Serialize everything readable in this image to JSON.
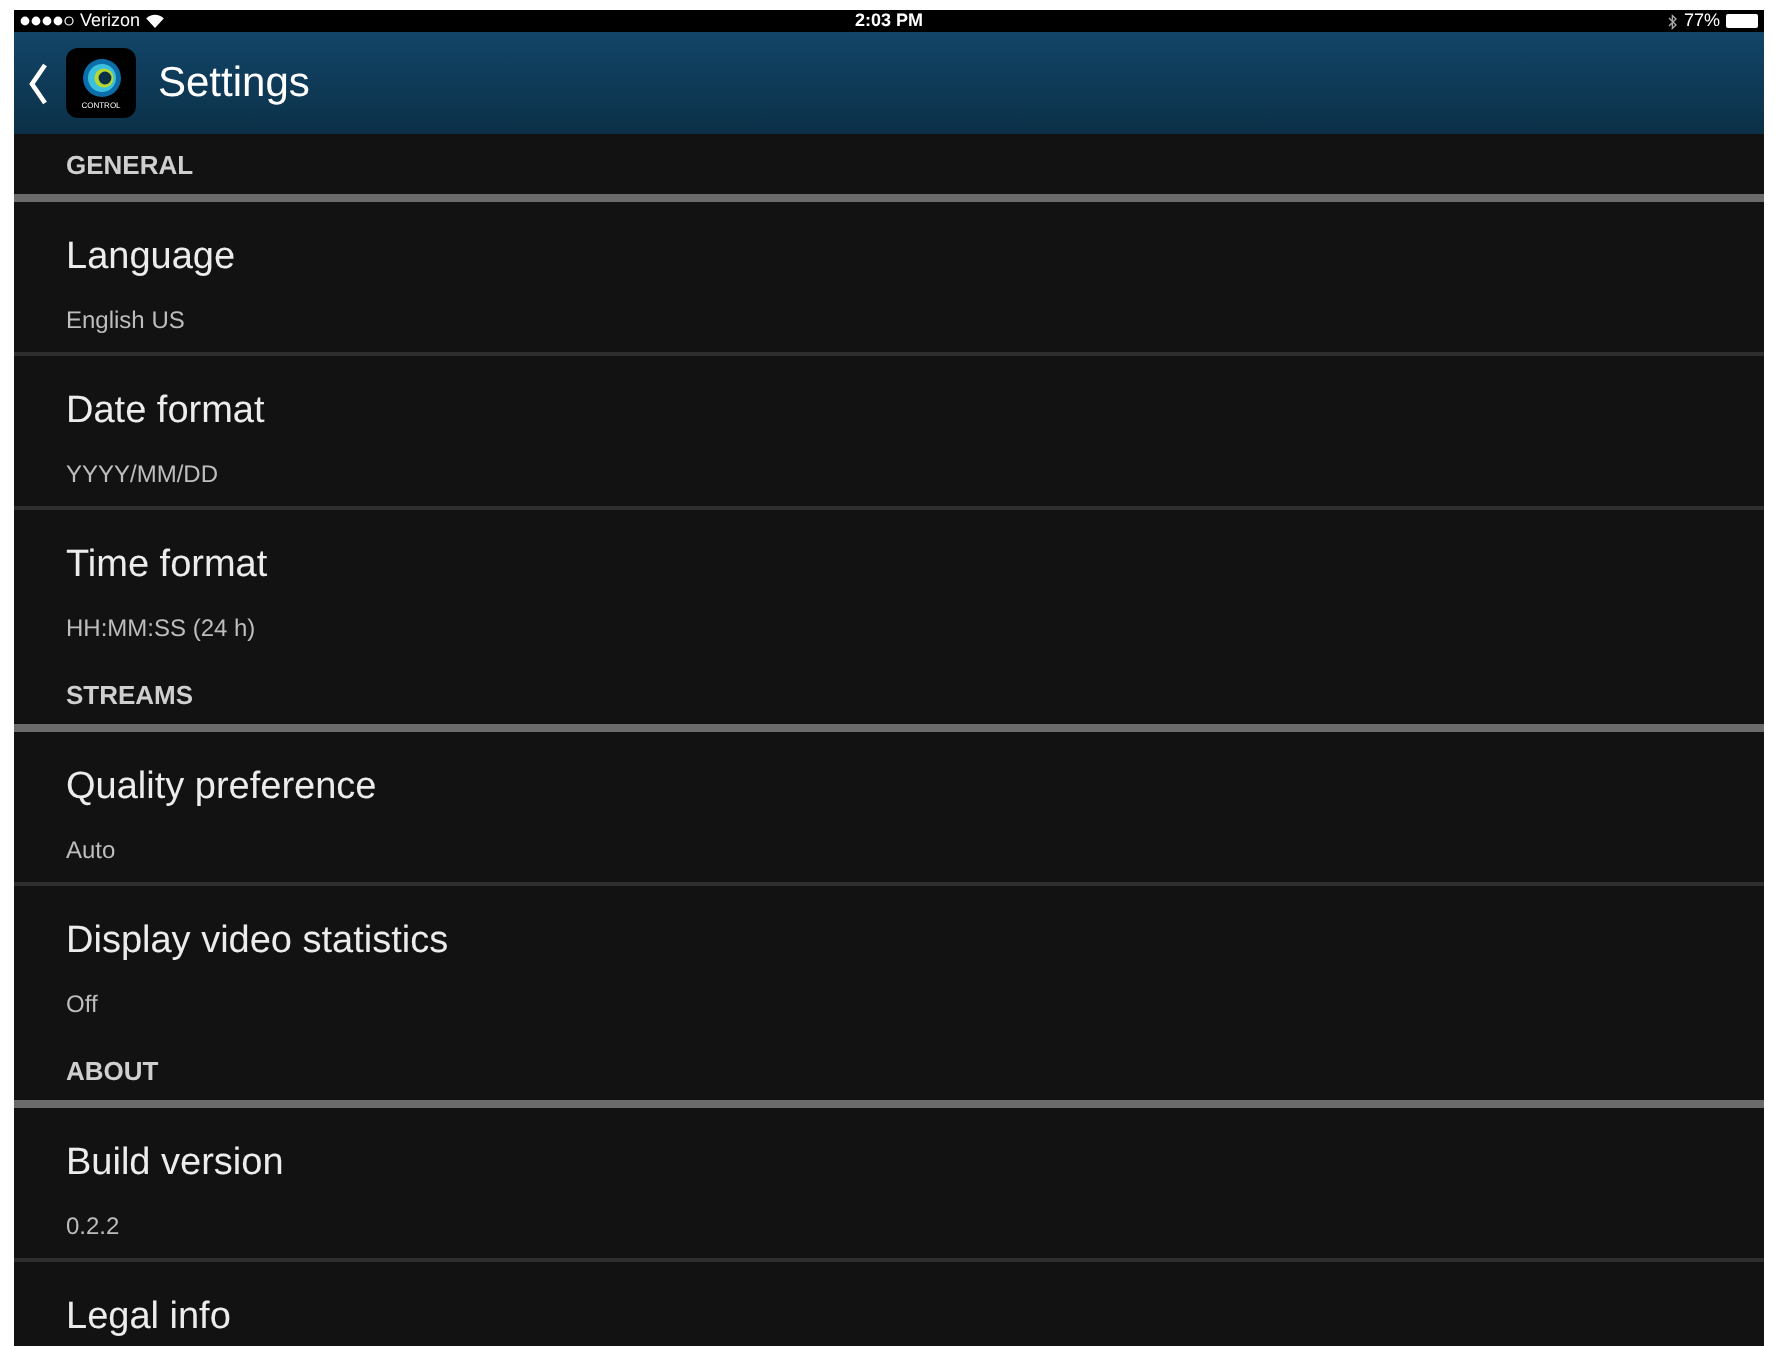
{
  "status_bar": {
    "carrier": "Verizon",
    "time": "2:03 PM",
    "battery": "77%"
  },
  "nav_bar": {
    "title": "Settings",
    "logo_text": "CONTROL"
  },
  "sections": [
    {
      "header": "GENERAL",
      "items": [
        {
          "title": "Language",
          "value": "English US"
        },
        {
          "title": "Date format",
          "value": "YYYY/MM/DD"
        },
        {
          "title": "Time format",
          "value": "HH:MM:SS (24 h)"
        }
      ]
    },
    {
      "header": "STREAMS",
      "items": [
        {
          "title": "Quality preference",
          "value": "Auto"
        },
        {
          "title": "Display video statistics",
          "value": "Off"
        }
      ]
    },
    {
      "header": "ABOUT",
      "items": [
        {
          "title": "Build version",
          "value": "0.2.2"
        },
        {
          "title": "Legal info"
        }
      ]
    }
  ]
}
